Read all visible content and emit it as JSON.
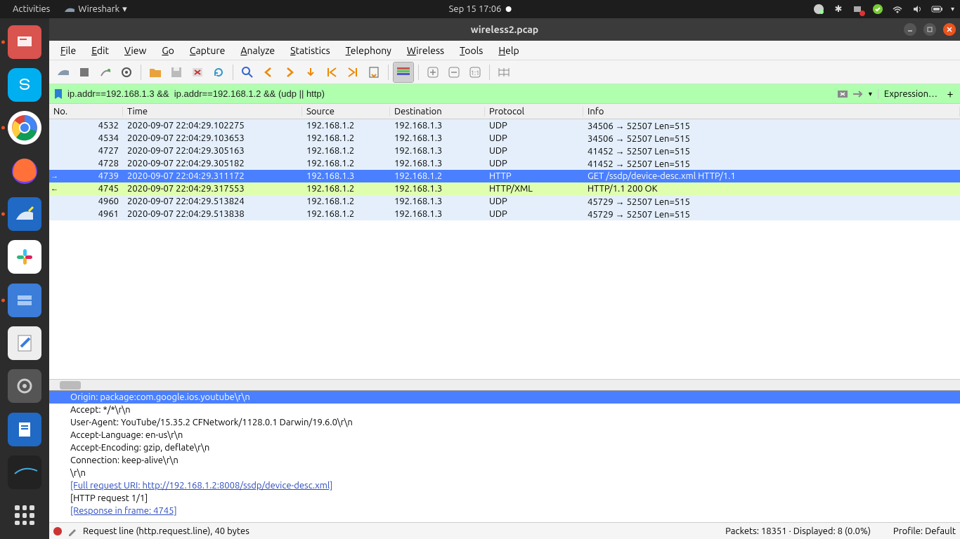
{
  "topbar": {
    "activities": "Activities",
    "app": "Wireshark",
    "datetime": "Sep 15  17:06"
  },
  "window": {
    "title": "wireless2.pcap"
  },
  "menubar": [
    {
      "label": "File",
      "accel": "F"
    },
    {
      "label": "Edit",
      "accel": "E"
    },
    {
      "label": "View",
      "accel": "V"
    },
    {
      "label": "Go",
      "accel": "G"
    },
    {
      "label": "Capture",
      "accel": "C"
    },
    {
      "label": "Analyze",
      "accel": "A"
    },
    {
      "label": "Statistics",
      "accel": "S"
    },
    {
      "label": "Telephony",
      "accel": "T"
    },
    {
      "label": "Wireless",
      "accel": "W"
    },
    {
      "label": "Tools",
      "accel": "T"
    },
    {
      "label": "Help",
      "accel": "H"
    }
  ],
  "filter": {
    "value": "ip.addr==192.168.1.3 &&  ip.addr==192.168.1.2 && (udp || http)",
    "expression_label": "Expression…"
  },
  "columns": {
    "no": "No.",
    "time": "Time",
    "source": "Source",
    "destination": "Destination",
    "protocol": "Protocol",
    "info": "Info"
  },
  "packets": [
    {
      "no": "4532",
      "time": "2020-09-07 22:04:29.102275",
      "src": "192.168.1.2",
      "dst": "192.168.1.3",
      "proto": "UDP",
      "info": "34506 → 52507 Len=515",
      "cls": "udp"
    },
    {
      "no": "4534",
      "time": "2020-09-07 22:04:29.103653",
      "src": "192.168.1.2",
      "dst": "192.168.1.3",
      "proto": "UDP",
      "info": "34506 → 52507 Len=515",
      "cls": "udp"
    },
    {
      "no": "4727",
      "time": "2020-09-07 22:04:29.305163",
      "src": "192.168.1.2",
      "dst": "192.168.1.3",
      "proto": "UDP",
      "info": "41452 → 52507 Len=515",
      "cls": "udp"
    },
    {
      "no": "4728",
      "time": "2020-09-07 22:04:29.305182",
      "src": "192.168.1.2",
      "dst": "192.168.1.3",
      "proto": "UDP",
      "info": "41452 → 52507 Len=515",
      "cls": "udp"
    },
    {
      "no": "4739",
      "time": "2020-09-07 22:04:29.311172",
      "src": "192.168.1.3",
      "dst": "192.168.1.2",
      "proto": "HTTP",
      "info": "GET /ssdp/device-desc.xml HTTP/1.1",
      "cls": "http",
      "marker": "→"
    },
    {
      "no": "4745",
      "time": "2020-09-07 22:04:29.317553",
      "src": "192.168.1.2",
      "dst": "192.168.1.3",
      "proto": "HTTP/XML",
      "info": "HTTP/1.1 200 OK",
      "cls": "httpxml",
      "marker": "←"
    },
    {
      "no": "4960",
      "time": "2020-09-07 22:04:29.513824",
      "src": "192.168.1.2",
      "dst": "192.168.1.3",
      "proto": "UDP",
      "info": "45729 → 52507 Len=515",
      "cls": "udp"
    },
    {
      "no": "4961",
      "time": "2020-09-07 22:04:29.513838",
      "src": "192.168.1.2",
      "dst": "192.168.1.3",
      "proto": "UDP",
      "info": "45729 → 52507 Len=515",
      "cls": "udp"
    }
  ],
  "details": [
    {
      "text": "Origin: package:com.google.ios.youtube\\r\\n",
      "selected": true
    },
    {
      "text": "Accept: */*\\r\\n"
    },
    {
      "text": "User-Agent: YouTube/15.35.2 CFNetwork/1128.0.1 Darwin/19.6.0\\r\\n"
    },
    {
      "text": "Accept-Language: en-us\\r\\n"
    },
    {
      "text": "Accept-Encoding: gzip, deflate\\r\\n"
    },
    {
      "text": "Connection: keep-alive\\r\\n"
    },
    {
      "text": "\\r\\n"
    },
    {
      "text": "[Full request URI: http://192.168.1.2:8008/ssdp/device-desc.xml]",
      "link": true
    },
    {
      "text": "[HTTP request 1/1]"
    },
    {
      "text": "[Response in frame: 4745]",
      "link": true
    }
  ],
  "statusbar": {
    "left": "Request line (http.request.line), 40 bytes",
    "mid": "Packets: 18351 · Displayed: 8 (0.0%)",
    "right": "Profile: Default"
  }
}
